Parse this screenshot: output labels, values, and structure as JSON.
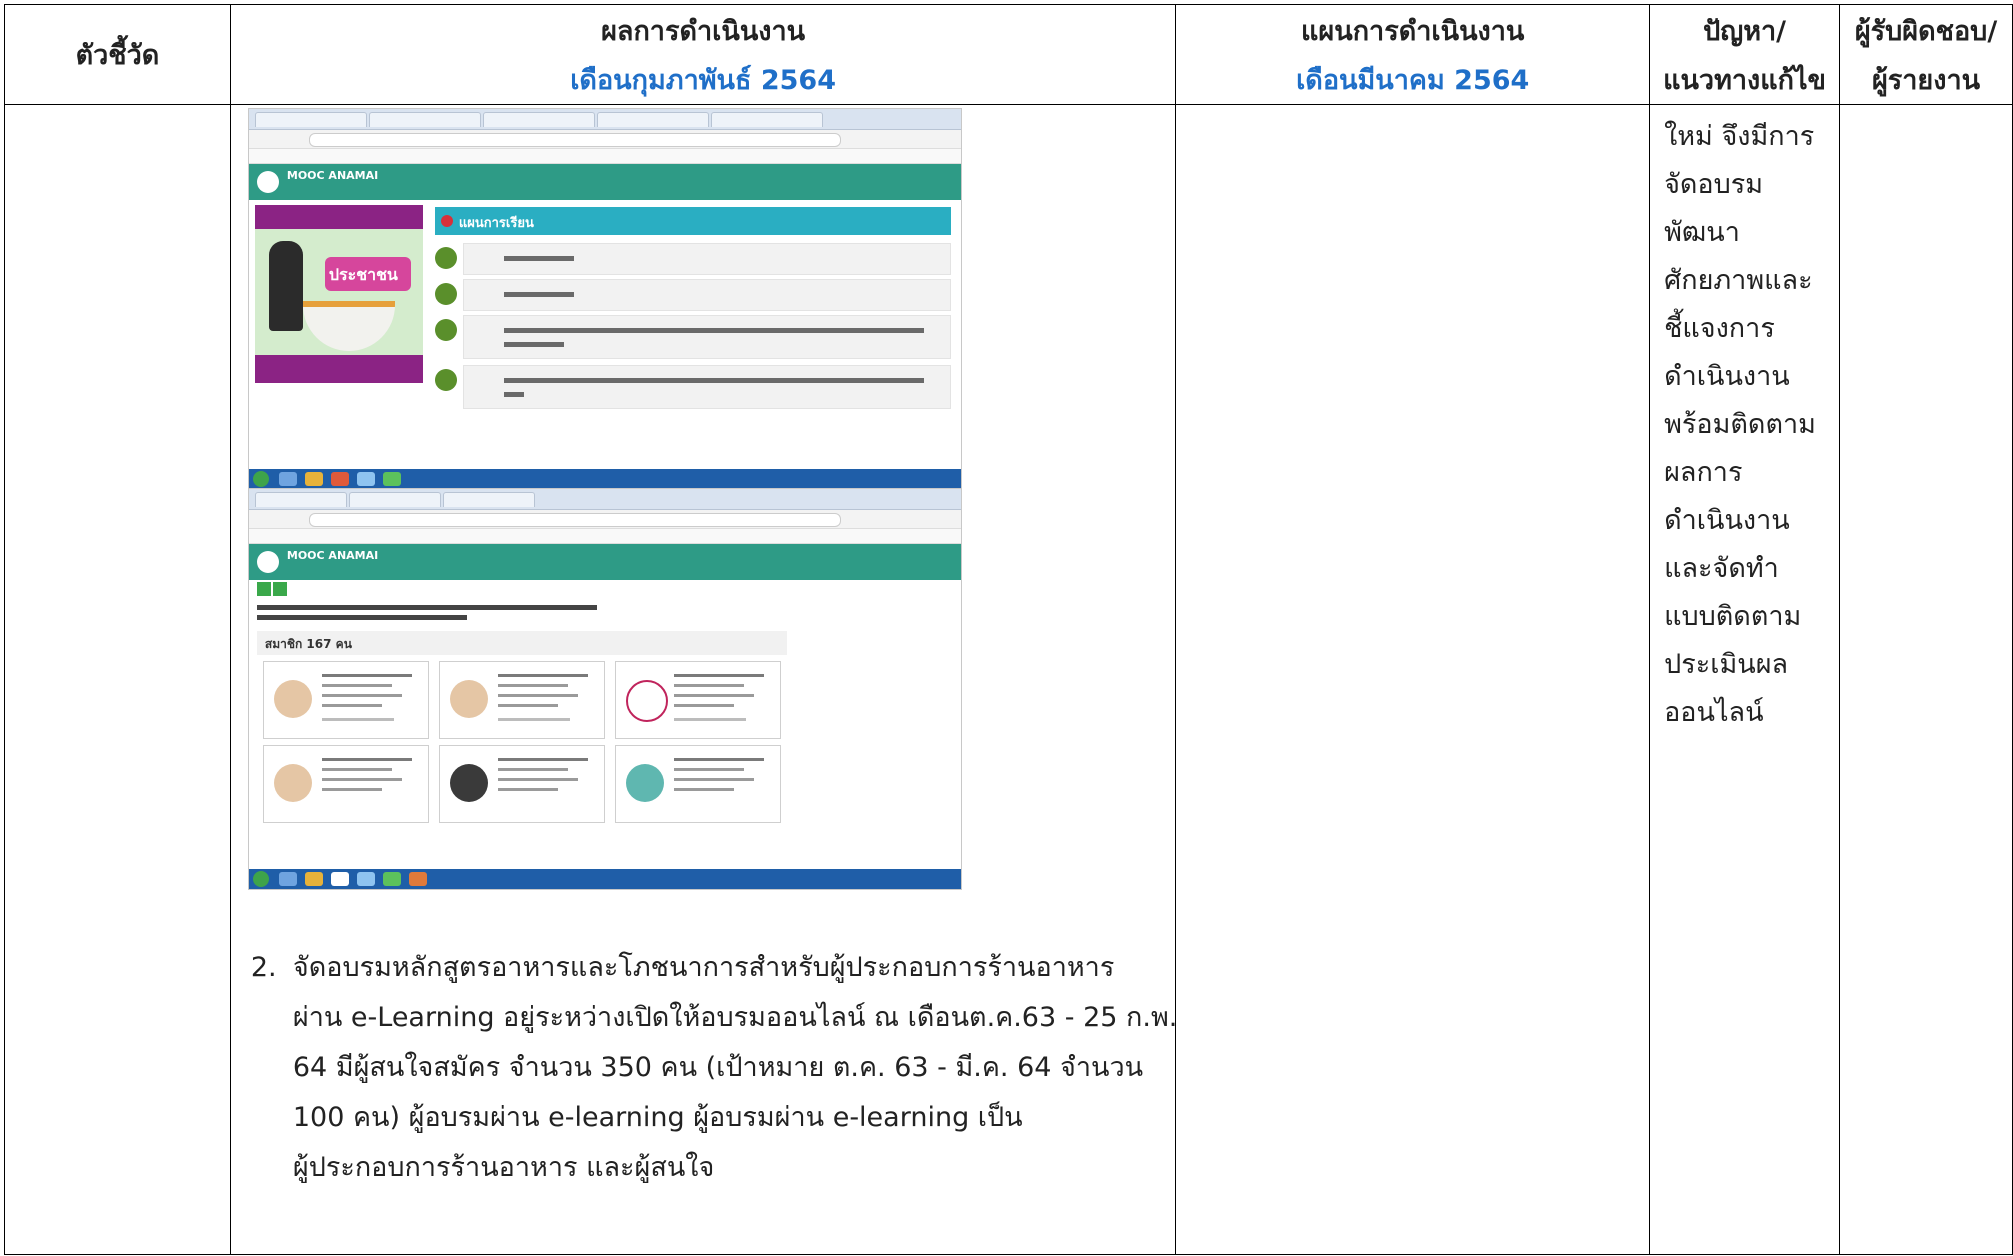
{
  "header": {
    "col1": "ตัวชี้วัด",
    "col2_title": "ผลการดำเนินงาน",
    "col2_sub": "เดือนกุมภาพันธ์ 2564",
    "col3_title": "แผนการดำเนินงาน",
    "col3_sub": "เดือนมีนาคม 2564",
    "col4_line1": "ปัญหา/",
    "col4_line2": "แนวทางแก้ไข",
    "col5_line1": "ผู้รับผิดชอบ/",
    "col5_line2": "ผู้รายงาน"
  },
  "problem_lines": [
    "ใหม่ จึงมีการ",
    "จัดอบรม",
    "พัฒนา",
    "ศักยภาพและ",
    "ชี้แจงการ",
    "ดำเนินงาน",
    "พร้อมติดตาม",
    "ผลการ",
    "ดำเนินงาน",
    "และจัดทำ",
    "แบบติดตาม",
    "ประเมินผล",
    "ออนไลน์"
  ],
  "work_item": {
    "number": "2.",
    "lines": [
      "จัดอบรมหลักสูตรอาหารและโภชนาการสำหรับผู้ประกอบการร้านอาหาร",
      "ผ่าน e-Learning อยู่ระหว่างเปิดให้อบรมออนไลน์ ณ เดือนต.ค.63 - 25 ก.พ.",
      "64 มีผู้สนใจสมัคร จำนวน 350 คน (เป้าหมาย ต.ค. 63 - มี.ค. 64 จำนวน",
      "100 คน) ผู้อบรมผ่าน e-learning  ผู้อบรมผ่าน e-learning เป็น",
      "ผู้ประกอบการร้านอาหาร และผู้สนใจ"
    ]
  },
  "screenshot1": {
    "site_name": "MOOC ANAMAI",
    "plan_header": "แผนการเรียน",
    "promo_tag": "ประชาชน"
  },
  "screenshot2": {
    "site_name": "MOOC ANAMAI",
    "members_label": "สมาชิก 167 คน"
  },
  "colors": {
    "sub_heading": "#1f6fc8",
    "site_green": "#2e9b86",
    "plan_header": "#2aaec2",
    "promo_purple": "#8b2384"
  }
}
